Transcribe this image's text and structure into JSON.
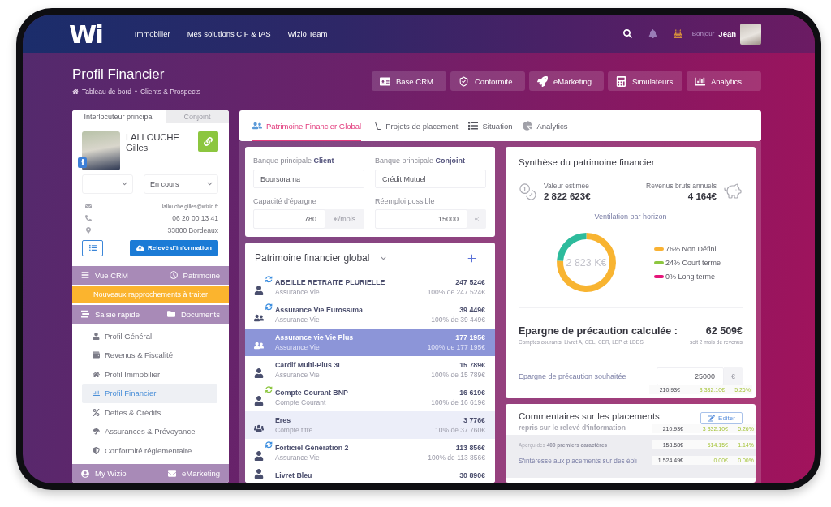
{
  "header": {
    "logo": "Wi",
    "nav": [
      "Immobilier",
      "Mes solutions CIF & IAS",
      "Wizio Team"
    ],
    "greeting": "Bonjour",
    "user": "Jean"
  },
  "page": {
    "title": "Profil Financier",
    "breadcrumb": [
      "Tableau de bord",
      "Clients & Prospects"
    ],
    "breadcrumb_separator": "•"
  },
  "toolbar": [
    "Base CRM",
    "Conformité",
    "eMarketing",
    "Simulateurs",
    "Analytics"
  ],
  "contact_panel": {
    "tabs": [
      {
        "label": "Interlocuteur principal",
        "selected": true
      },
      {
        "label": "Conjoint",
        "selected": false
      }
    ],
    "last_name": "LALLOUCHE",
    "first_name": "Gilles",
    "status": "En cours",
    "email": "lallouche.gilles@wizio.fr",
    "phone": "06 20 00 13 41",
    "address": "33800 Bordeaux",
    "report_button": "Relevé d'information",
    "links_top": [
      "Vue CRM",
      "Patrimoine"
    ],
    "alert": "Nouveaux rapprochements à traiter",
    "links_middle": [
      "Saisie rapide",
      "Documents"
    ],
    "menu": [
      {
        "label": "Profil Général",
        "selected": false
      },
      {
        "label": "Revenus & Fiscalité",
        "selected": false
      },
      {
        "label": "Profil Immobilier",
        "selected": false
      },
      {
        "label": "Profil Financier",
        "selected": true
      },
      {
        "label": "Dettes & Crédits",
        "selected": false
      },
      {
        "label": "Assurances & Prévoyance",
        "selected": false
      },
      {
        "label": "Conformité réglementaire",
        "selected": false
      }
    ],
    "links_bottom": [
      "My Wizio",
      "eMarketing"
    ]
  },
  "content_tabs": [
    {
      "label": "Patrimoine Financier Global",
      "selected": true
    },
    {
      "label": "Projets de placement",
      "selected": false
    },
    {
      "label": "Situation",
      "selected": false
    },
    {
      "label": "Analytics",
      "selected": false
    }
  ],
  "banks": {
    "fields": [
      {
        "label": "Banque principale **Client**",
        "value": "Boursorama"
      },
      {
        "label": "Banque principale **Conjoint**",
        "value": "Crédit Mutuel"
      },
      {
        "label": "Capacité d'épargne",
        "value": "780",
        "unit": "€/mois"
      },
      {
        "label": "Réemploi possible",
        "value": "15000",
        "unit": "€"
      }
    ]
  },
  "assets": {
    "title": "Patrimoine financier global",
    "rows": [
      {
        "kind": "single",
        "sync": true,
        "color": "#3d8fe0",
        "name": "ABEILLE RETRAITE PLURIELLE",
        "type": "Assurance Vie",
        "amount": "247 524€",
        "share": "100% de 247 524€",
        "selected": false,
        "hovered": false
      },
      {
        "kind": "couple",
        "sync": true,
        "color": "#3d8fe0",
        "name": "Assurance Vie Eurossima",
        "type": "Assurance Vie",
        "amount": "39 449€",
        "share": "100% de 39 449€",
        "selected": false,
        "hovered": false
      },
      {
        "kind": "couple",
        "sync": false,
        "name": "Assurance vie Vie Plus",
        "type": "Assurance Vie",
        "amount": "177 195€",
        "share": "100% de 177 195€",
        "selected": true,
        "hovered": false
      },
      {
        "kind": "single",
        "sync": false,
        "name": "Cardif Multi-Plus 3I",
        "type": "Assurance Vie",
        "amount": "15 789€",
        "share": "100% de 15 789€",
        "selected": false,
        "hovered": false
      },
      {
        "kind": "single",
        "sync": true,
        "color": "#8cc63f",
        "name": "Compte Courant BNP",
        "type": "Compte Courant",
        "amount": "16 619€",
        "share": "100% de 16 619€",
        "selected": false,
        "hovered": false
      },
      {
        "kind": "group",
        "sync": false,
        "name": "Eres",
        "type": "Compte titre",
        "amount": "3 776€",
        "share": "10% de 37 760€",
        "selected": false,
        "hovered": true
      },
      {
        "kind": "single",
        "sync": true,
        "color": "#3d8fe0",
        "name": "Forticiel Génération 2",
        "type": "Assurance Vie",
        "amount": "113 856€",
        "share": "100% de 113 856€",
        "selected": false,
        "hovered": false
      },
      {
        "kind": "single",
        "sync": false,
        "name": "Livret Bleu",
        "amount": "30 890€",
        "selected": false,
        "hovered": false
      }
    ]
  },
  "synthesis": {
    "title": "Synthèse du patrimoine financier",
    "estimated_label": "Valeur estimée",
    "estimated_value": "2 822 623€",
    "income_label": "Revenus bruts annuels",
    "income_value": "4 164€",
    "chart_data": {
      "type": "donut",
      "title": "Ventilation par horizon",
      "categories": [
        "76% Non Défini",
        "24% Court terme",
        "0% Long terme"
      ],
      "values": [
        76,
        24,
        0
      ]
    },
    "donut_slices": [
      {
        "color": "#f8b431"
      },
      {
        "color": "#2dbb9c"
      }
    ],
    "center_label": "2 823 K€",
    "legend": [
      {
        "color": "#f9b233"
      },
      {
        "color": "#8dc63f"
      },
      {
        "color": "#e5157a"
      }
    ],
    "precaution_title": "Epargne de précaution calculée :",
    "precaution_value": "62 509€",
    "precaution_note": "Comptes courants, Livret A, CEL, CER, LEP et LDDS",
    "precaution_months": "soit 2 mois de revenus",
    "wished_label": "Epargne de précaution souhaitée",
    "wished_value": "25000",
    "wished_unit": "€",
    "wished_figures": [
      "210.93€",
      "3 332.10€",
      "5.26%"
    ]
  },
  "comments": {
    "title": "Commentaires sur les placements",
    "subtitle": "repris sur le relevé d'information",
    "edit_button": "Editer",
    "preview_hint": "Aperçu des **400 premiers caractères**",
    "text": "S'intéresse aux placements sur des éoli",
    "figures": [
      [
        "210.93€",
        "3 332.10€",
        "5.26%"
      ],
      [
        "158.58€",
        "514.15€",
        "1.14%"
      ],
      [
        "1 524.49€",
        "0.00€",
        "0.00%"
      ]
    ]
  }
}
